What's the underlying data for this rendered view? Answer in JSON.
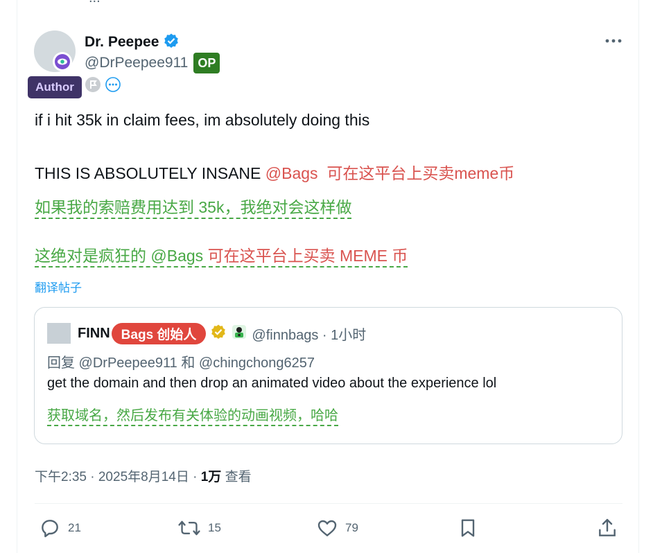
{
  "top_fragment": "...",
  "author": {
    "display_name": "Dr. Peepee",
    "handle": "@DrPeepee911",
    "op_label": "OP",
    "author_label": "Author"
  },
  "post": {
    "line1": "if i hit 35k in claim fees, im absolutely doing this",
    "line2_text": "THIS IS ABSOLUTELY INSANE ",
    "line2_mention": "@Bags",
    "line2_red_cn": "可在这平台上买卖meme币",
    "tr1": "如果我的索赔费用达到 35k，我绝对会这样做",
    "tr2_green": "这绝对是疯狂的 @Bags ",
    "tr2_red": "可在这平台上买卖 MEME 币",
    "translate_link": "翻译帖子"
  },
  "quote": {
    "name": "FINN",
    "pill": "Bags 创始人",
    "handle_time": "@finnbags · 1小时",
    "reply_to": "回复 @DrPeepee911 和 @chingchong6257",
    "body": "get the domain and then drop an animated video about the experience lol",
    "translation": "获取域名，然后发布有关体验的动画视频，哈哈"
  },
  "meta": {
    "time_date": "下午2:35 · 2025年8月14日 · ",
    "views": "1万",
    "views_label": " 查看"
  },
  "actions": {
    "replies": "21",
    "reposts": "15",
    "likes": "79"
  },
  "colors": {
    "verified": "#1d9bf0",
    "op_badge": "#2f7d23",
    "author_tag": "#3f3367",
    "red_annotation": "#d9534f",
    "green_translation": "#48a845",
    "quote_pill": "#e0463d"
  }
}
